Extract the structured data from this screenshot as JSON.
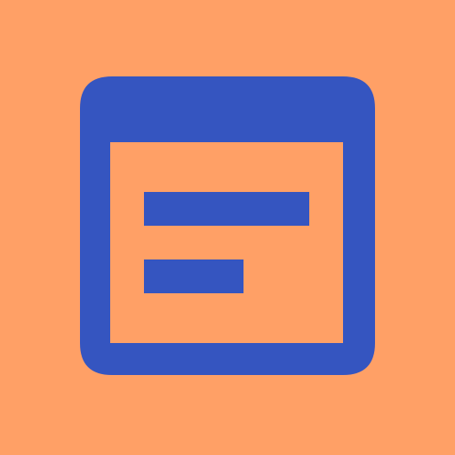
{
  "icon": {
    "name": "web-asset-icon",
    "colors": {
      "background": "#FFA066",
      "foreground": "#3555C0"
    }
  }
}
